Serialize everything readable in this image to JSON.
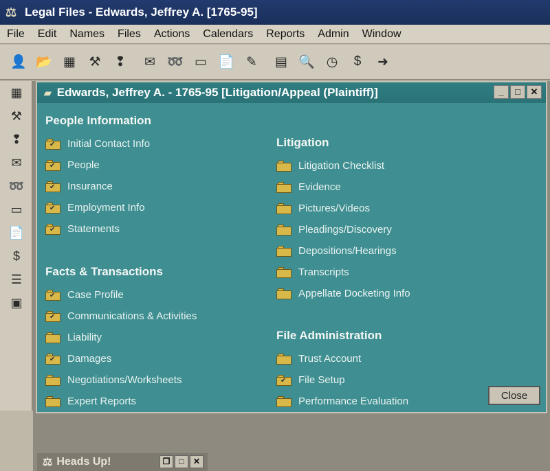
{
  "app": {
    "title": "Legal Files - Edwards, Jeffrey A. [1765-95]"
  },
  "menu": [
    "File",
    "Edit",
    "Names",
    "Files",
    "Actions",
    "Calendars",
    "Reports",
    "Admin",
    "Window"
  ],
  "toolbar_icons": [
    "user-switch-icon",
    "folder-open-icon",
    "grid-icon",
    "tools-icon",
    "footprints-icon",
    "envelope-icon",
    "tape-icon",
    "card-icon",
    "document-icon",
    "wand-icon",
    "calculator-icon",
    "magnifier-icon",
    "clock-icon",
    "dollar-icon",
    "exit-icon"
  ],
  "sidebar_icons": [
    "grid-icon",
    "tools-icon",
    "footprints-icon",
    "envelope-icon",
    "tape-icon",
    "card-icon",
    "document-icon",
    "dollar-icon",
    "checklist-icon",
    "report-icon"
  ],
  "file_window": {
    "title": "Edwards, Jeffrey A. - 1765-95 [Litigation/Appeal (Plaintiff)]",
    "left": {
      "sections": [
        {
          "heading": "People Information",
          "items": [
            "Initial Contact Info",
            "People",
            "Insurance",
            "Employment Info",
            "Statements"
          ]
        },
        {
          "heading": "Facts & Transactions",
          "items": [
            "Case Profile",
            "Communications & Activities",
            "Liability",
            "Damages",
            "Negotiations/Worksheets",
            "Expert Reports"
          ]
        }
      ]
    },
    "right": {
      "sections": [
        {
          "heading": "Litigation",
          "items": [
            "Litigation Checklist",
            "Evidence",
            "Pictures/Videos",
            "Pleadings/Discovery",
            "Depositions/Hearings",
            "Transcripts",
            "Appellate Docketing Info"
          ]
        },
        {
          "heading": "File Administration",
          "items": [
            "Trust Account",
            "File Setup",
            "Performance Evaluation"
          ]
        }
      ]
    },
    "close_label": "Close"
  },
  "heads_up": {
    "title": "Heads Up!"
  }
}
